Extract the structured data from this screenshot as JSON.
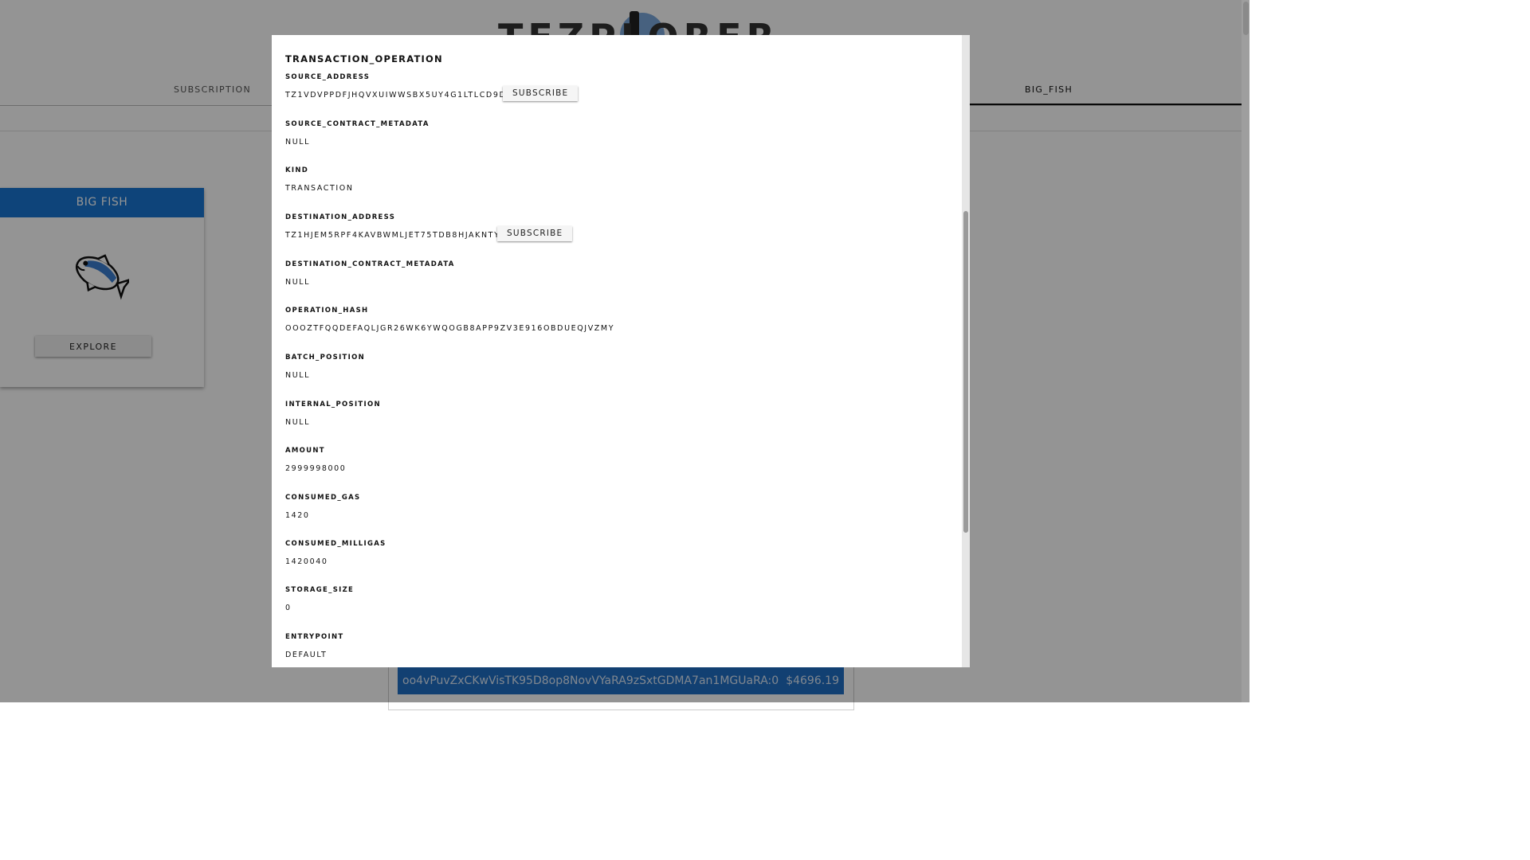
{
  "header": {
    "logo_text": "TEZPLORER"
  },
  "nav": {
    "items": [
      {
        "label": "SUBSCRIPTION"
      },
      {
        "label": "BIG_FISH"
      }
    ]
  },
  "card": {
    "title": "BIG FISH",
    "icon": "fish-icon",
    "button_label": "EXPLORE"
  },
  "transactions": [
    {
      "hash": "oo4vPuvZxCKwVisTK95D8op8NovVYaRA9zSxtGDMA7an1MGUaRA:0",
      "amount": "$4696.19"
    }
  ],
  "dialog": {
    "title": "TRANSACTION_OPERATION",
    "subscribe_label": "SUBSCRIBE",
    "fields": [
      {
        "label": "SOURCE_ADDRESS",
        "value": "TZ1VDVPPDFJHQVXUIWWSBX5UY4G1LTLCD9DR"
      },
      {
        "label": "SOURCE_CONTRACT_METADATA",
        "value": "NULL"
      },
      {
        "label": "KIND",
        "value": "TRANSACTION"
      },
      {
        "label": "DESTINATION_ADDRESS",
        "value": "TZ1HJEM5RPF4KAVBWMLJET75TDB8HJAKNTYK"
      },
      {
        "label": "DESTINATION_CONTRACT_METADATA",
        "value": "NULL"
      },
      {
        "label": "OPERATION_HASH",
        "value": "OOOZTFQQDEFAQLJGR26WK6YWQOGB8APP9ZV3E916OBDUEQJVZMY"
      },
      {
        "label": "BATCH_POSITION",
        "value": "NULL"
      },
      {
        "label": "INTERNAL_POSITION",
        "value": "NULL"
      },
      {
        "label": "AMOUNT",
        "value": "2999998000"
      },
      {
        "label": "CONSUMED_GAS",
        "value": "1420"
      },
      {
        "label": "CONSUMED_MILLIGAS",
        "value": "1420040"
      },
      {
        "label": "STORAGE_SIZE",
        "value": "0"
      },
      {
        "label": "ENTRYPOINT",
        "value": "DEFAULT"
      }
    ]
  }
}
